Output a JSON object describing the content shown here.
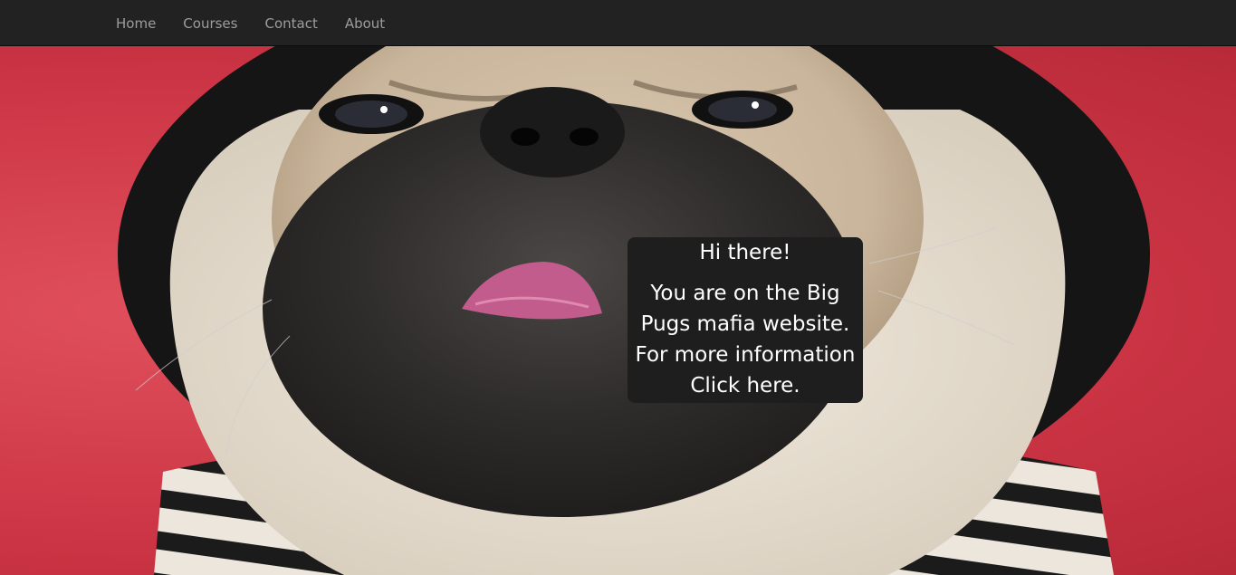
{
  "nav": {
    "items": [
      {
        "label": "Home"
      },
      {
        "label": "Courses"
      },
      {
        "label": "Contact"
      },
      {
        "label": "About"
      }
    ]
  },
  "hero": {
    "image": "pug-in-striped-hoodie",
    "info": {
      "title": "Hi there!",
      "line1": "You are on the Big",
      "line2": "Pugs mafia website.",
      "line3": "For more information",
      "link": "Click here."
    }
  },
  "colors": {
    "navbar_bg": "#222222",
    "nav_text": "#9d9d9d",
    "info_box_bg": "#1e1e1e",
    "background_red": "#cc3545"
  }
}
